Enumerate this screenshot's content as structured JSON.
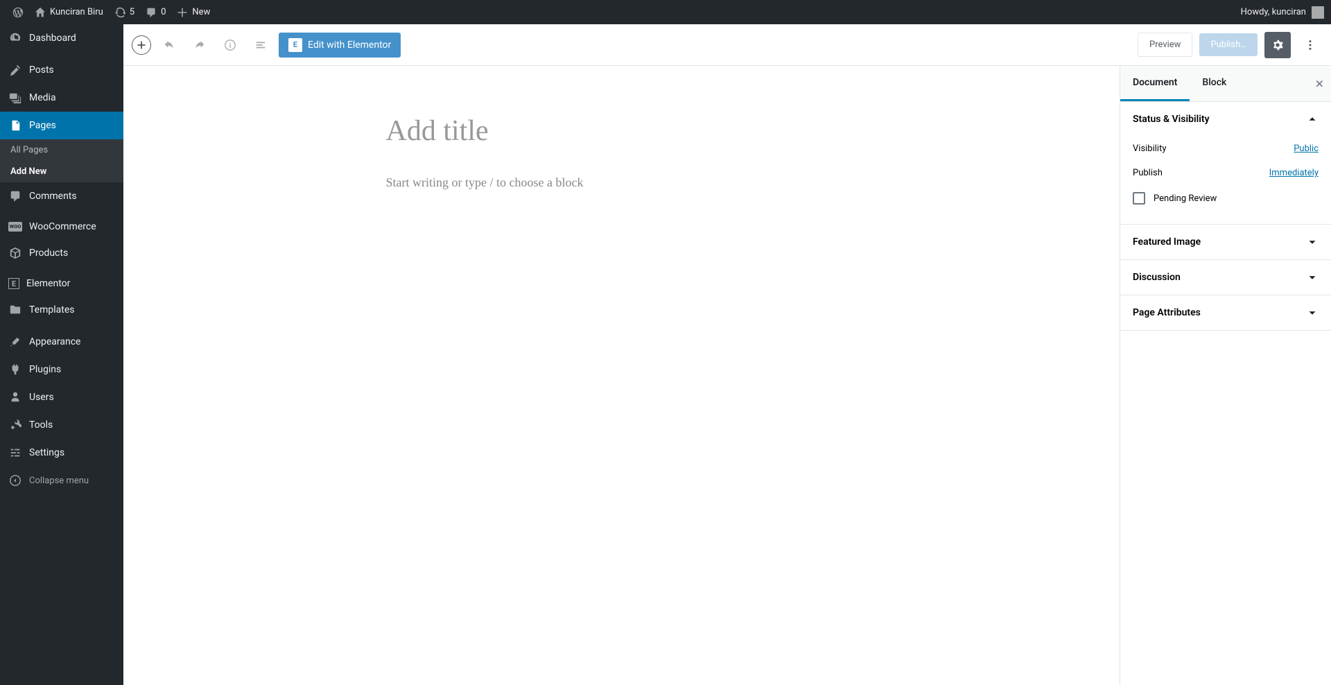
{
  "adminBar": {
    "siteName": "Kunciran Biru",
    "updates": "5",
    "comments": "0",
    "newLabel": "New",
    "greeting": "Howdy, kunciran"
  },
  "sidebar": {
    "dashboard": "Dashboard",
    "posts": "Posts",
    "media": "Media",
    "pages": "Pages",
    "allPages": "All Pages",
    "addNew": "Add New",
    "commentsMenu": "Comments",
    "woocommerce": "WooCommerce",
    "products": "Products",
    "elementor": "Elementor",
    "templates": "Templates",
    "appearance": "Appearance",
    "plugins": "Plugins",
    "users": "Users",
    "tools": "Tools",
    "settings": "Settings",
    "collapse": "Collapse menu"
  },
  "toolbar": {
    "elementorLabel": "Edit with Elementor",
    "elementorIcon": "E",
    "preview": "Preview",
    "publish": "Publish…"
  },
  "editor": {
    "titlePlaceholder": "Add title",
    "bodyPlaceholder": "Start writing or type / to choose a block"
  },
  "panel": {
    "tabDocument": "Document",
    "tabBlock": "Block",
    "statusVisibility": "Status & Visibility",
    "visibilityLabel": "Visibility",
    "visibilityValue": "Public",
    "publishLabel": "Publish",
    "publishValue": "Immediately",
    "pendingReview": "Pending Review",
    "featuredImage": "Featured Image",
    "discussion": "Discussion",
    "pageAttributes": "Page Attributes"
  }
}
